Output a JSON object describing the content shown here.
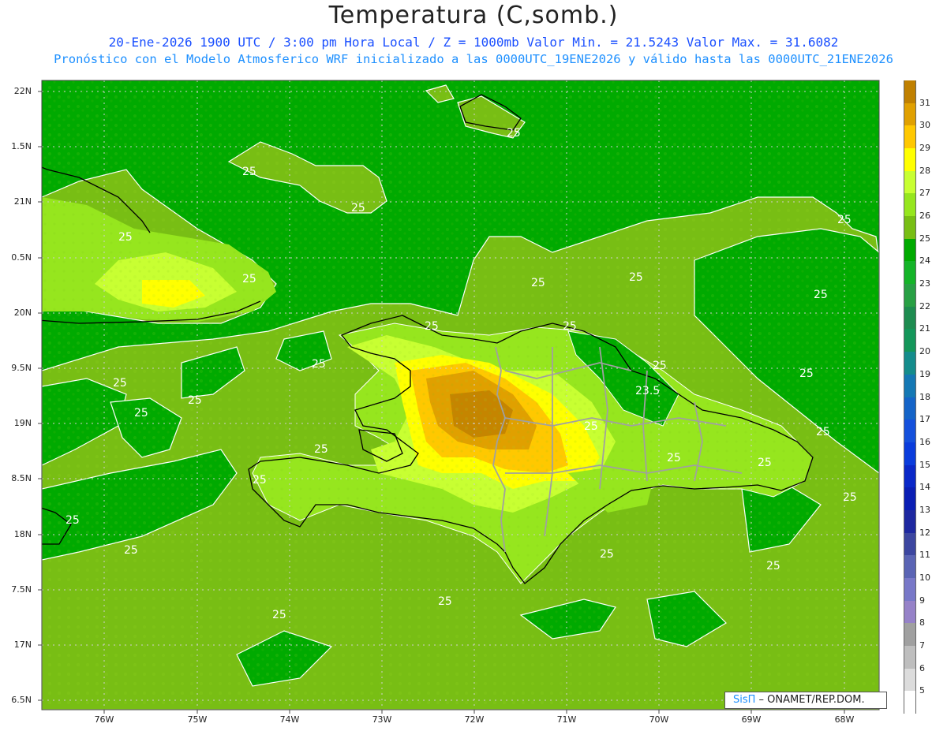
{
  "header": {
    "title": "Temperatura (C,somb.)",
    "line1": "20-Ene-2026  1900 UTC / 3:00 pm Hora Local / Z = 1000mb   Valor Min. = 21.5243  Valor Max. = 31.6082",
    "line2": "Pronóstico con el Modelo Atmosferico WRF inicializado a las 0000UTC_19ENE2026 y válido hasta las  0000UTC_21ENE2026"
  },
  "credit": {
    "brand": "SisΠ",
    "org": " – ONAMET/REP.DOM."
  },
  "axes": {
    "lat_labels": [
      "22N",
      "1.5N",
      "21N",
      "0.5N",
      "20N",
      "9.5N",
      "19N",
      "8.5N",
      "18N",
      "7.5N",
      "17N",
      "6.5N"
    ],
    "lon_labels": [
      "76W",
      "75W",
      "74W",
      "73W",
      "72W",
      "71W",
      "70W",
      "69W",
      "68W"
    ]
  },
  "colorbar": {
    "labels": [
      "31",
      "30",
      "29",
      "28",
      "27",
      "26",
      "25",
      "24",
      "23",
      "22",
      "21",
      "20",
      "19",
      "18",
      "17",
      "16",
      "15",
      "14",
      "13",
      "12",
      "11",
      "10",
      "9",
      "8",
      "7",
      "6",
      "5"
    ],
    "colors": [
      "#c08000",
      "#e0a000",
      "#ffc800",
      "#ffff00",
      "#c8ff32",
      "#96e61e",
      "#78be14",
      "#00aa00",
      "#14b428",
      "#28a044",
      "#1e8c50",
      "#14965a",
      "#148c8c",
      "#1478b4",
      "#1464c8",
      "#1450dc",
      "#0a3cdc",
      "#0a28c8",
      "#0a1eb4",
      "#1e28a0",
      "#3c46a0",
      "#5a64b4",
      "#7878c8",
      "#9682c8",
      "#a0a0a0",
      "#bebebe",
      "#dcdcdc",
      "#ffffff"
    ]
  },
  "contour_labels": [
    "25",
    "25",
    "25",
    "25",
    "25",
    "25",
    "25",
    "25",
    "25",
    "25",
    "25",
    "25",
    "25",
    "25",
    "25",
    "25",
    "25",
    "25",
    "25",
    "25",
    "25",
    "25",
    "25",
    "25",
    "25",
    "25",
    "25",
    "25",
    "25",
    "25",
    "23.5"
  ],
  "colors": {
    "ocean": "#00aa00",
    "text_blue": "#1a4fff"
  }
}
